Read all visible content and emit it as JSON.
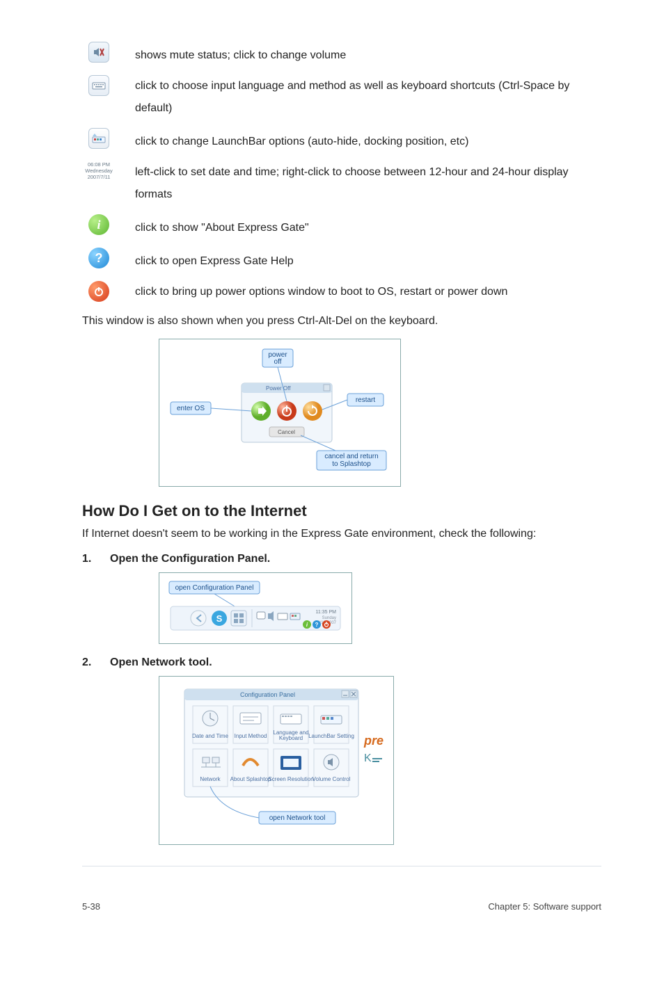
{
  "icons": {
    "mute": {
      "name": "mute-speaker-icon",
      "desc": "shows mute status; click to change volume"
    },
    "keyboard": {
      "name": "keyboard-icon",
      "desc": "click to choose input language and method as well as keyboard shortcuts (Ctrl-Space by default)"
    },
    "launchbar": {
      "name": "launchbar-options-icon",
      "desc": "click to change LaunchBar options (auto-hide, docking position, etc)"
    },
    "datetime": {
      "name": "date-time-panel-icon",
      "sample": "06:08 PM\nWednesday\n2007/7/11",
      "desc": "left-click to set date and time; right-click to choose between 12-hour and 24-hour display formats"
    },
    "about": {
      "name": "info-icon",
      "desc": "click to show \"About Express Gate\""
    },
    "help": {
      "name": "help-icon",
      "desc": "click to open Express Gate Help"
    },
    "power": {
      "name": "power-icon",
      "desc": "click to bring up power options window to boot to OS, restart or power down"
    }
  },
  "after_icons_line": "This window is also shown when you press Ctrl-Alt-Del on the keyboard.",
  "power_dialog": {
    "title": "Power Off",
    "cancel_btn": "Cancel",
    "callouts": {
      "enter_os": "enter OS",
      "power_off": "power\noff",
      "restart": "restart",
      "cancel_return": "cancel and return\nto Splashtop"
    }
  },
  "section_heading": "How Do I Get on to the Internet",
  "section_intro": "If Internet doesn't seem to be working in the Express Gate environment, check the following:",
  "steps": {
    "s1": {
      "num": "1.",
      "text": "Open the Configuration Panel."
    },
    "s2": {
      "num": "2.",
      "text": "Open Network tool."
    }
  },
  "step1_fig": {
    "callout": "open Configuration Panel",
    "time1": "11:35 PM",
    "time2": "Sunday",
    "time3": "2/10/2007"
  },
  "step2_fig": {
    "title": "Configuration Panel",
    "cells": {
      "date_time": "Date and Time",
      "input_method": "Input Method",
      "lang_kbd": "Language and\nKeyboard",
      "launchbar_setting": "LaunchBar Setting",
      "network": "Network",
      "about_splashtop": "About Splashtop",
      "screen_resolution": "Screen Resolution",
      "volume_control": "Volume Control"
    },
    "callout": "open Network tool"
  },
  "footer": {
    "left": "5-38",
    "right": "Chapter 5: Software support"
  }
}
